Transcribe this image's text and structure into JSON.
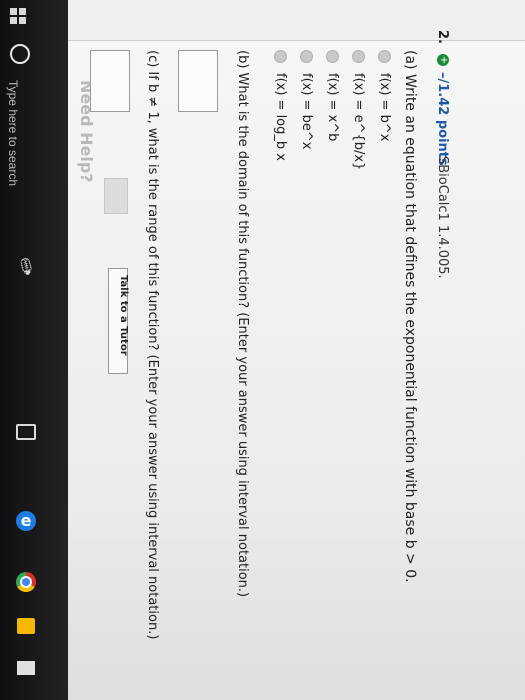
{
  "taskbar": {
    "search_placeholder": "Type here to search"
  },
  "header": {
    "need_help": "Need Help?",
    "tutor_button": "Talk to a Tutor"
  },
  "question": {
    "number": "2.",
    "plus": "+",
    "points": "–/1.42 points",
    "source": "SBioCalc1 1.4.005.",
    "part_a": "(a) Write an equation that defines the exponential function with base b > 0.",
    "options": [
      "f(x) = b^x",
      "f(x) = e^{b/x}",
      "f(x) = x^b",
      "f(x) = be^x",
      "f(x) = log_b x"
    ],
    "part_b": "(b) What is the domain of this function? (Enter your answer using interval notation.)",
    "part_c": "(c) If b ≠ 1, what is the range of this function? (Enter your answer using interval notation.)"
  }
}
